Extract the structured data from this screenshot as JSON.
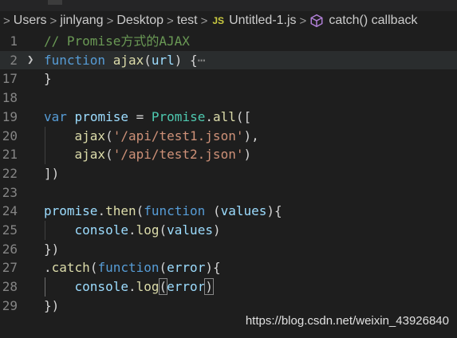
{
  "breadcrumb": {
    "items": [
      "Users",
      "jinlyang",
      "Desktop",
      "test"
    ],
    "file_badge": "JS",
    "file_name": "Untitled-1.js",
    "symbol": "catch() callback",
    "separator": ">"
  },
  "editor": {
    "line_numbers": [
      "1",
      "2",
      "17",
      "18",
      "19",
      "20",
      "21",
      "22",
      "23",
      "24",
      "25",
      "26",
      "27",
      "28",
      "29"
    ],
    "code": {
      "l1": "// Promise方式的AJAX",
      "l2_kw": "function",
      "l2_fn": "ajax",
      "l2_param": "url",
      "l2_ellipsis": "⋯",
      "l19_kw": "var",
      "l19_var": "promise",
      "l19_cls": "Promise",
      "l19_method": "all",
      "l20_fn": "ajax",
      "l20_str": "'/api/test1.json'",
      "l21_fn": "ajax",
      "l21_str": "'/api/test2.json'",
      "l24_var": "promise",
      "l24_method": "then",
      "l24_kw": "function",
      "l24_param": "values",
      "l25_obj": "console",
      "l25_method": "log",
      "l25_arg": "values",
      "l27_method": "catch",
      "l27_kw": "function",
      "l27_param": "error",
      "l28_obj": "console",
      "l28_method": "log",
      "l28_arg": "error"
    }
  },
  "watermark": "https://blog.csdn.net/weixin_43926840",
  "colors": {
    "background": "#1e1e1e",
    "comment": "#6a9955",
    "keyword": "#569cd6",
    "function": "#dcdcaa",
    "variable": "#9cdcfe",
    "class": "#4ec9b0",
    "string": "#ce9178"
  }
}
